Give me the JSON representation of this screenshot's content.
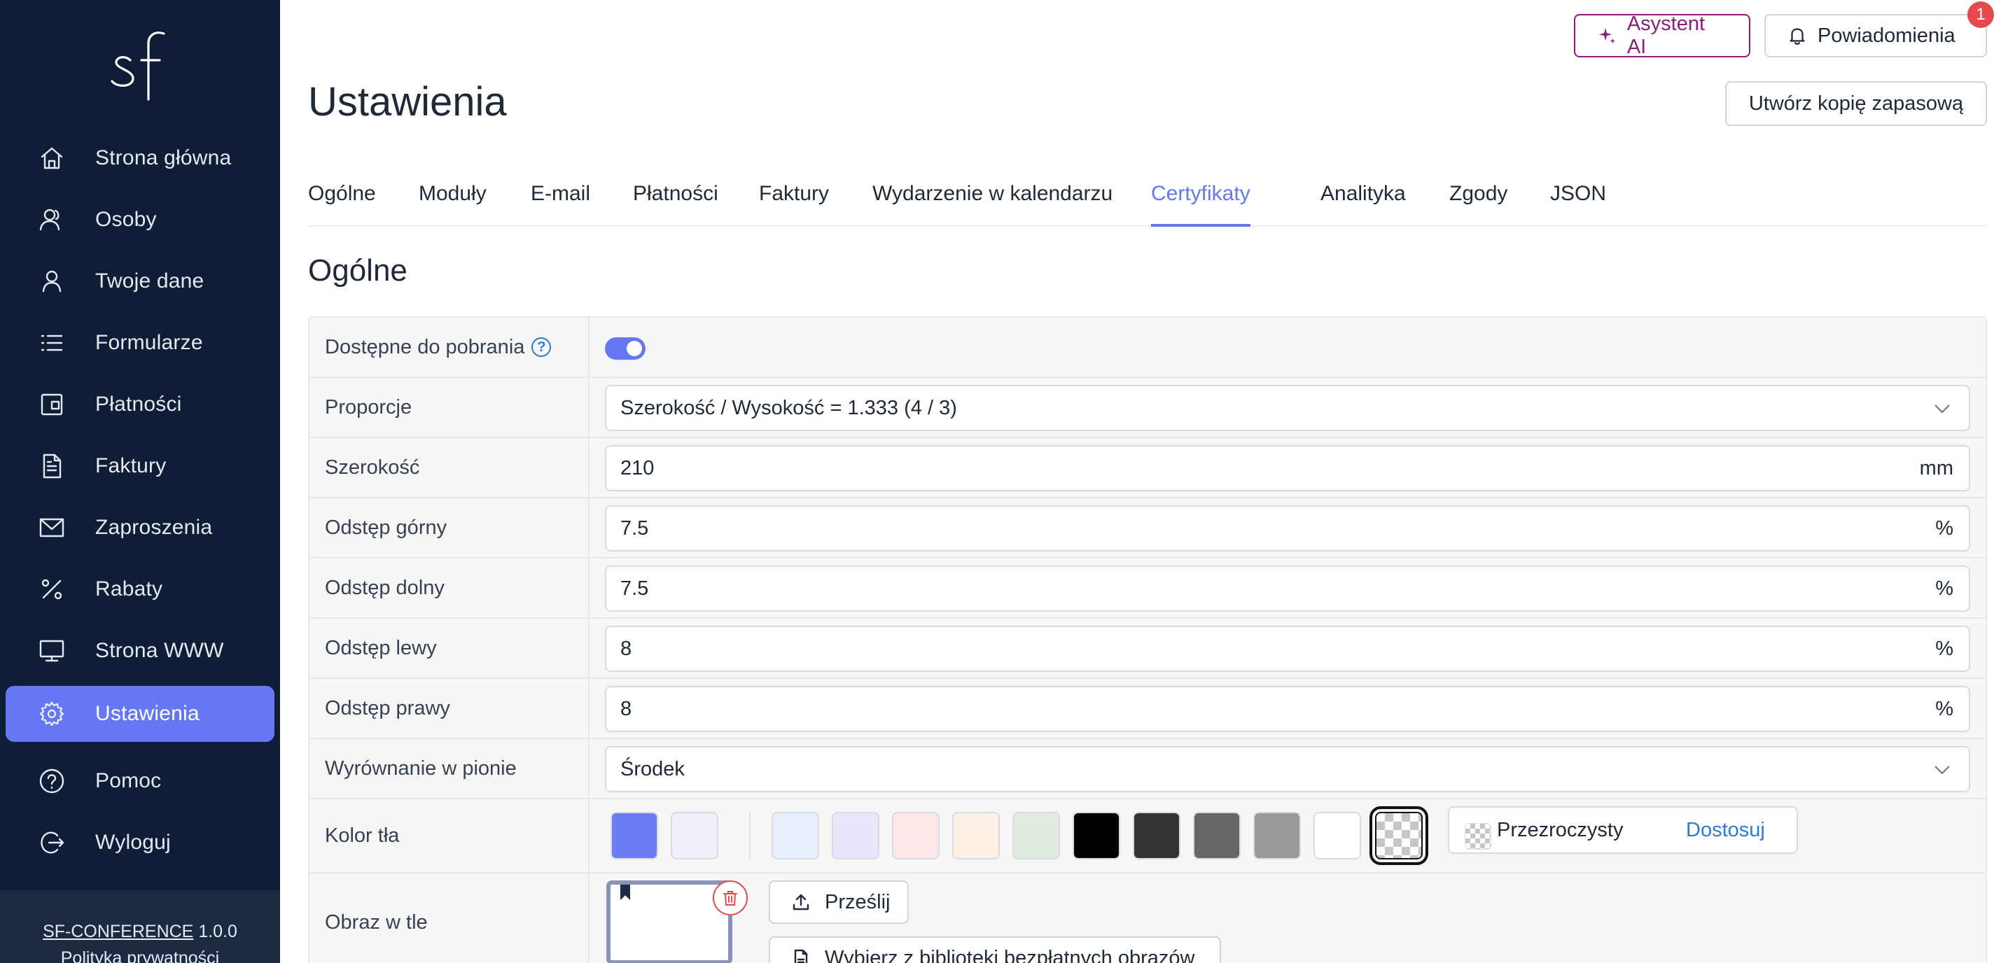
{
  "logo_text": "sf",
  "sidebar": {
    "items": [
      {
        "label": "Strona główna",
        "icon": "home-icon"
      },
      {
        "label": "Osoby",
        "icon": "users-icon"
      },
      {
        "label": "Twoje dane",
        "icon": "user-icon"
      },
      {
        "label": "Formularze",
        "icon": "list-icon"
      },
      {
        "label": "Płatności",
        "icon": "wallet-icon"
      },
      {
        "label": "Faktury",
        "icon": "document-icon"
      },
      {
        "label": "Zaproszenia",
        "icon": "mail-icon"
      },
      {
        "label": "Rabaty",
        "icon": "percent-icon"
      },
      {
        "label": "Strona WWW",
        "icon": "monitor-icon"
      },
      {
        "label": "Ustawienia",
        "icon": "gear-icon",
        "active": true
      },
      {
        "label": "Pomoc",
        "icon": "help-icon"
      },
      {
        "label": "Wyloguj",
        "icon": "logout-icon"
      }
    ],
    "footer": {
      "brand": "SF-CONFERENCE",
      "version": "1.0.0",
      "privacy": "Polityka prywatności"
    }
  },
  "header": {
    "ai_label": "Asystent AI",
    "notifications_label": "Powiadomienia",
    "notifications_count": "1",
    "backup_label": "Utwórz kopię zapasową"
  },
  "page_title": "Ustawienia",
  "tabs": [
    {
      "label": "Ogólne"
    },
    {
      "label": "Moduły"
    },
    {
      "label": "E-mail"
    },
    {
      "label": "Płatności"
    },
    {
      "label": "Faktury"
    },
    {
      "label": "Wydarzenie w kalendarzu"
    },
    {
      "label": "Certyfikaty",
      "active": true
    },
    {
      "label": "Analityka"
    },
    {
      "label": "Zgody"
    },
    {
      "label": "JSON"
    }
  ],
  "section_title": "Ogólne",
  "form": {
    "downloadable": {
      "label": "Dostępne do pobrania",
      "help": "?",
      "enabled": true
    },
    "proportion": {
      "label": "Proporcje",
      "value": "Szerokość / Wysokość = 1.333 (4 / 3)"
    },
    "width": {
      "label": "Szerokość",
      "value": "210",
      "unit": "mm"
    },
    "margin_top": {
      "label": "Odstęp górny",
      "value": "7.5",
      "unit": "%"
    },
    "margin_bottom": {
      "label": "Odstęp dolny",
      "value": "7.5",
      "unit": "%"
    },
    "margin_left": {
      "label": "Odstęp lewy",
      "value": "8",
      "unit": "%"
    },
    "margin_right": {
      "label": "Odstęp prawy",
      "value": "8",
      "unit": "%"
    },
    "vertical_align": {
      "label": "Wyrównanie w pionie",
      "value": "Środek"
    },
    "background_color": {
      "label": "Kolor tła",
      "swatches": [
        "#6b7cf5",
        "#eeeff8",
        "#e9f0fd",
        "#e9e6fb",
        "#fde6e8",
        "#fdf1e5",
        "#e2ebe0",
        "#000000",
        "#333333",
        "#666666",
        "#999999",
        "#ffffff",
        "transparent"
      ],
      "selected": "transparent",
      "selected_name": "Przezroczysty",
      "customize": "Dostosuj"
    },
    "background_image": {
      "label": "Obraz w tle",
      "upload": "Prześlij",
      "library": "Wybierz z biblioteki bezpłatnych obrazów"
    }
  },
  "colors": {
    "accent": "#6577f3",
    "sidebar": "#0f1d36",
    "ai": "#8a1e78",
    "danger": "#e5484d",
    "link": "#2b7bd6"
  }
}
